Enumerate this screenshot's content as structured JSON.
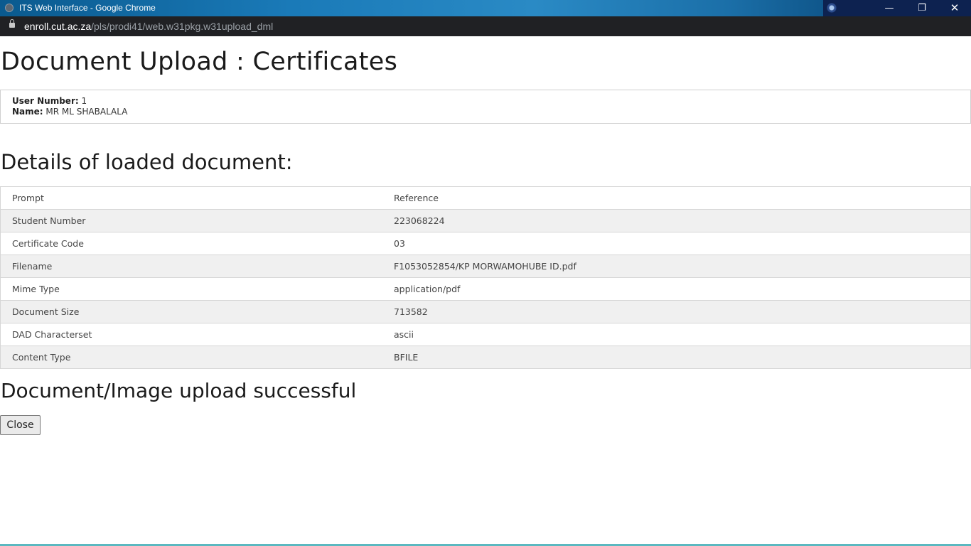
{
  "window": {
    "title": "ITS Web Interface - Google Chrome",
    "minimize_glyph": "—",
    "restore_glyph": "❐",
    "close_glyph": "✕"
  },
  "address_bar": {
    "host": "enroll.cut.ac.za",
    "path": "/pls/prodi41/web.w31pkg.w31upload_dml"
  },
  "page": {
    "title": "Document Upload : Certificates",
    "user": {
      "number_label": "User Number:",
      "number_value": "1",
      "name_label": "Name:",
      "name_value": "MR ML SHABALALA"
    },
    "details_title": "Details of loaded document:",
    "table": {
      "headers": [
        "Prompt",
        "Reference"
      ],
      "rows": [
        [
          "Student Number",
          "223068224"
        ],
        [
          "Certificate Code",
          "03"
        ],
        [
          "Filename",
          "F1053052854/KP MORWAMOHUBE ID.pdf"
        ],
        [
          "Mime Type",
          "application/pdf"
        ],
        [
          "Document Size",
          "713582"
        ],
        [
          "DAD Characterset",
          "ascii"
        ],
        [
          "Content Type",
          "BFILE"
        ]
      ]
    },
    "status_message": "Document/Image upload successful",
    "close_button": "Close"
  }
}
